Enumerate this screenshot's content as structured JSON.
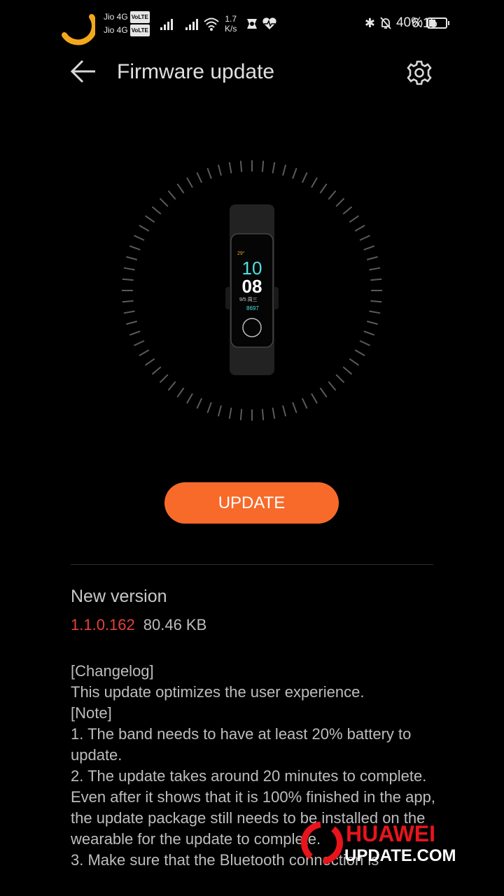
{
  "status_bar": {
    "carrier1": "Jio 4G",
    "carrier2": "Jio 4G",
    "volte": "VoLTE",
    "speed_value": "1.7",
    "speed_unit": "K/s",
    "battery": "40%",
    "battery_level": 0.4,
    "time": "6:15",
    "icons": [
      "loading-arc-icon",
      "signal-icon",
      "signal-icon",
      "wifi-icon",
      "app-icon",
      "heart-rate-icon",
      "bluetooth-icon",
      "mute-bell-icon",
      "battery-icon"
    ]
  },
  "header": {
    "title": "Firmware update"
  },
  "device": {
    "screen_time_hour": "10",
    "screen_time_min": "08",
    "screen_date": "9/5 周三",
    "screen_steps": "8697",
    "screen_weather": "29°"
  },
  "update_button": "UPDATE",
  "version": {
    "label": "New version",
    "number": "1.1.0.162",
    "size": "80.46 KB"
  },
  "notes": [
    "[Changelog]",
    "This update optimizes the user experience.",
    "[Note]",
    "1. The band needs to have at least 20% battery to update.",
    "2. The update takes around 20 minutes to complete. Even after it shows that it is 100% finished in the app, the update package still needs to be installed on the wearable for the update to complete.",
    "3. Make sure that the Bluetooth connection is"
  ],
  "watermark": {
    "line1": "HUAWEI",
    "line2": "UPDATE.COM"
  },
  "colors": {
    "accent": "#f86a2a",
    "version": "#e8413c",
    "loader": "#f3a81b"
  }
}
